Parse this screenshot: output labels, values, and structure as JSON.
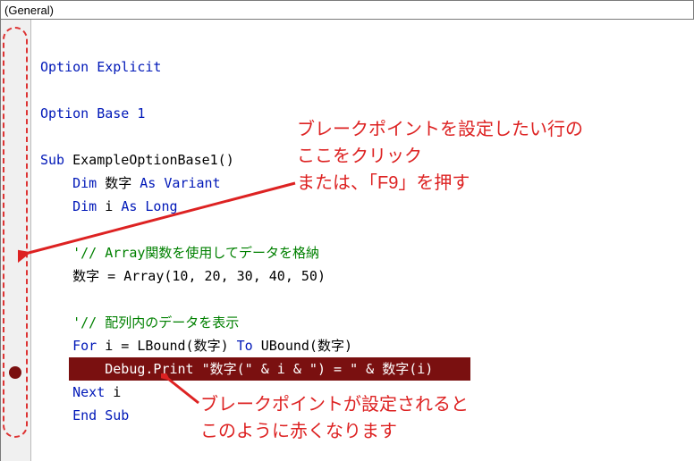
{
  "dropdown": {
    "value": "(General)"
  },
  "code": {
    "l1": "Option Explicit",
    "l2": "Option Base 1",
    "l3_sub": "Sub",
    "l3_name": " ExampleOptionBase1()",
    "l4_dim": "Dim",
    "l4_rest": " 数字 ",
    "l4_as": "As Variant",
    "l5_dim": "Dim",
    "l5_rest": " i ",
    "l5_as": "As Long",
    "l6": "'// Array関数を使用してデータを格納",
    "l7": "    数字 = Array(10, 20, 30, 40, 50)",
    "l8": "'// 配列内のデータを表示",
    "l9_for": "For",
    "l9_rest": " i = LBound(数字) ",
    "l9_to": "To",
    "l9_rest2": " UBound(数字)",
    "l10": "Debug.Print \"数字(\" & i & \") = \" & 数字(i)",
    "l11": "Next",
    "l11_rest": " i",
    "l12": "End Sub"
  },
  "anno": {
    "top1": "ブレークポイントを設定したい行の",
    "top2": "ここをクリック",
    "top3": "または、「F9」を押す",
    "bot1": "ブレークポイントが設定されると",
    "bot2": "このように赤くなります"
  }
}
